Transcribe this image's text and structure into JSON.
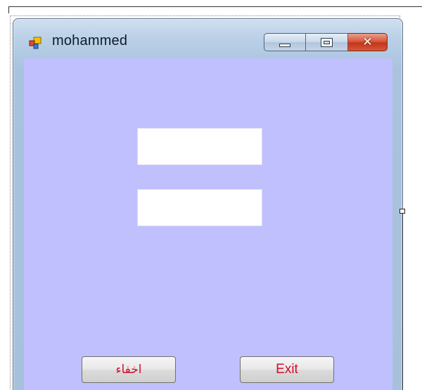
{
  "window": {
    "title": "mohammed",
    "app_icon": "winforms-app-icon",
    "caption_buttons": {
      "minimize_icon": "minimize-icon",
      "maximize_icon": "maximize-icon",
      "close_icon": "close-icon",
      "close_glyph": "✕"
    }
  },
  "form": {
    "background_color": "#c0c0ff",
    "fields": [
      {
        "value": "",
        "placeholder": ""
      },
      {
        "value": "",
        "placeholder": ""
      }
    ],
    "buttons": {
      "hide_label": "اخفاء",
      "exit_label": "Exit"
    },
    "button_text_color": "#d0102a"
  }
}
